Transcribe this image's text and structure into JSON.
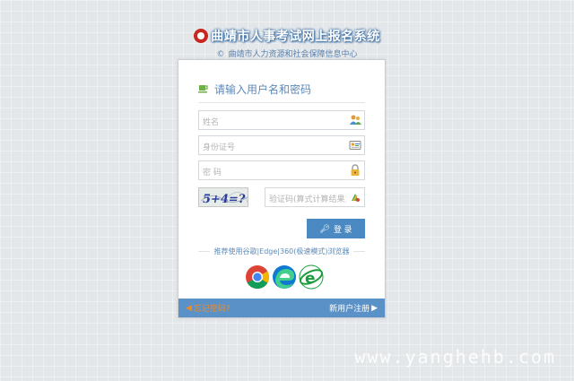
{
  "header": {
    "title": "曲靖市人事考试网上报名系统",
    "subtitle_prefix": "©",
    "subtitle": "曲靖市人力资源和社会保障信息中心"
  },
  "login": {
    "heading": "请输入用户名和密码",
    "name_placeholder": "姓名",
    "id_placeholder": "身份证号",
    "password_placeholder": "密 码",
    "captcha_placeholder": "验证码(算式计算结果)",
    "captcha_text": "5+4=?",
    "login_button": "登 录",
    "browser_tip": "推荐使用谷歌|Edge|360(极速模式)浏览器"
  },
  "footer": {
    "forgot": "忘记密码?",
    "register": "新用户注册"
  },
  "watermark": "www.yanghehb.com",
  "icons": {
    "logo": "emblem-icon",
    "heading": "cup-icon",
    "name": "users-icon",
    "id": "id-card-icon",
    "password": "lock-icon",
    "captcha": "refresh-icon",
    "button": "key-icon",
    "browsers": [
      "chrome-icon",
      "edge-icon",
      "ie-icon"
    ]
  },
  "colors": {
    "accent": "#4a89c2",
    "title_glow": "#3a6fa8",
    "footer_bar": "#5a92c8",
    "forgot_link": "#f08a24"
  }
}
